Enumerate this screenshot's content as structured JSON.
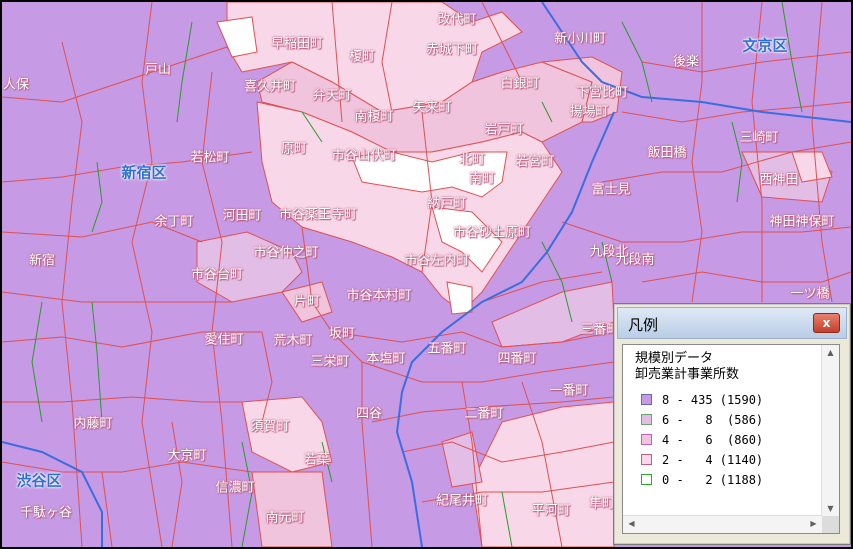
{
  "map": {
    "ward_labels": [
      {
        "id": "bunkyo",
        "text": "文京区"
      },
      {
        "id": "shinjuku",
        "text": "新宿区"
      },
      {
        "id": "shibuya",
        "text": "渋谷区"
      }
    ],
    "town_labels": [
      "改代町",
      "早稲田町",
      "榎町",
      "赤城下町",
      "新小川町",
      "後楽",
      "戸山",
      "人保",
      "喜久井町",
      "弁天町",
      "白銀町",
      "下宮比町",
      "南榎町",
      "矢来町",
      "揚場町",
      "岩戸町",
      "原町",
      "市谷山伏町",
      "若松町",
      "北町",
      "若宮町",
      "飯田橋",
      "三崎町",
      "南町",
      "西神田",
      "富士見",
      "河田町",
      "市谷薬王寺町",
      "納戸町",
      "神田神保町",
      "余丁町",
      "市谷砂土原町",
      "九段北",
      "市谷仲之町",
      "新宿",
      "市谷左内町",
      "九段南",
      "市谷台町",
      "一ツ橋",
      "片町",
      "市谷本村町",
      "三番町",
      "坂町",
      "愛住町",
      "荒木町",
      "五番町",
      "本塩町",
      "三栄町",
      "四番町",
      "一番町",
      "四谷",
      "二番町",
      "内藤町",
      "須賀町",
      "大京町",
      "若葉",
      "信濃町",
      "紀尾井町",
      "平河町",
      "隼町",
      "千駄ヶ谷",
      "南元町"
    ]
  },
  "legend": {
    "title": "凡例",
    "close_label": "x",
    "heading_line1": "規模別データ",
    "heading_line2": "卸売業計事業所数",
    "entries": [
      {
        "label": "8 - 435 (1590)",
        "fill": "#c69ae4",
        "stroke": "#6a6aa8"
      },
      {
        "label": "6 -   8  (586)",
        "fill": "#e2bde6",
        "stroke": "#6aa86a"
      },
      {
        "label": "4 -   6  (860)",
        "fill": "#f0c4dc",
        "stroke": "#c060c0"
      },
      {
        "label": "2 -   4 (1140)",
        "fill": "#f8d8e8",
        "stroke": "#c06080"
      },
      {
        "label": "0 -   2 (1188)",
        "fill": "#ffffff",
        "stroke": "#2aa82a"
      }
    ]
  },
  "colors": {
    "class_high": "#c69ae4",
    "class_mid_high": "#e2bde6",
    "class_mid": "#f0c4dc",
    "class_low": "#f8d8e8",
    "class_lowest": "#ffffff",
    "town_border": "#e05050",
    "ward_border": "#3a6ee0",
    "block_border": "#2a9a2a"
  }
}
